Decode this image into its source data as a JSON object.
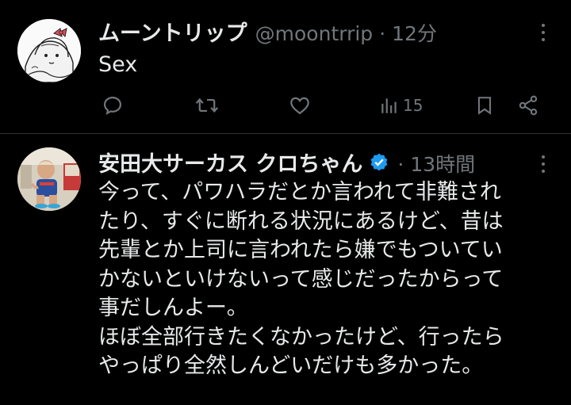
{
  "tweets": [
    {
      "display_name": "ムーントリップ",
      "handle": "@moontrrip",
      "separator": "·",
      "time": "12分",
      "text": "Sex",
      "views": "15"
    },
    {
      "display_name": "安田大サーカス クロちゃん",
      "separator": "·",
      "time": "13時間",
      "text_lines": [
        "今って、パワハラだとか言われて非難され",
        "たり、すぐに断れる状況にあるけど、昔は",
        "先輩とか上司に言われたら嫌でもついてい",
        "かないといけないって感じだったからって",
        "事だしんよー。",
        "ほぼ全部行きたくなかったけど、行ったら",
        "やっぱり全然しんどいだけも多かった。"
      ]
    }
  ],
  "icons": {
    "reply": "reply-icon",
    "retweet": "retweet-icon",
    "like": "heart-icon",
    "views": "views-icon",
    "bookmark": "bookmark-icon",
    "share": "share-icon",
    "verified": "verified-badge-icon",
    "more": "more-icon"
  },
  "colors": {
    "background": "#000000",
    "text": "#e7e9ea",
    "muted": "#71767b",
    "verified": "#1d9bf0",
    "divider": "#2f3336"
  }
}
